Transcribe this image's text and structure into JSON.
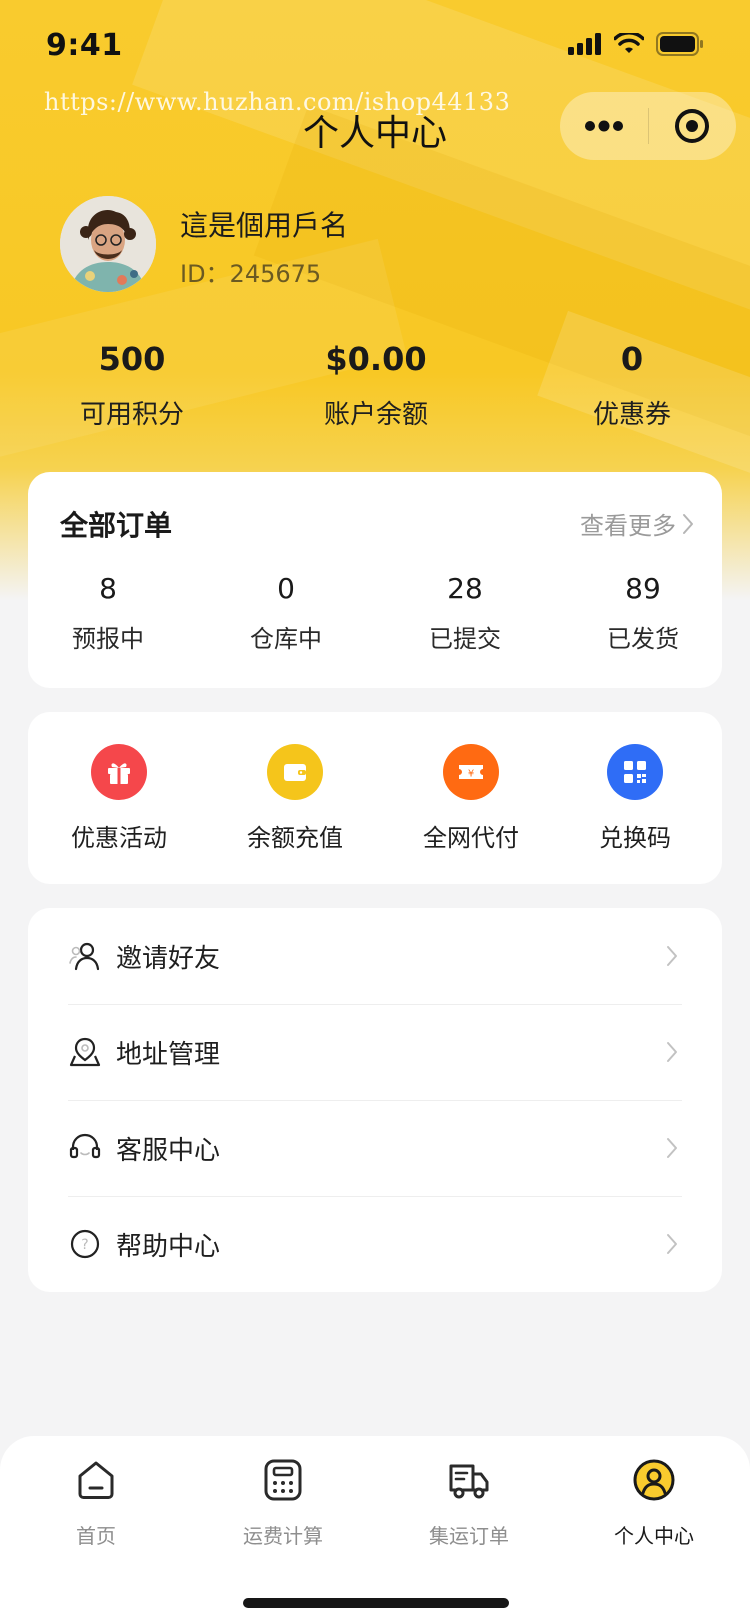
{
  "status_bar": {
    "time": "9:41",
    "icons": [
      "signal-icon",
      "wifi-icon",
      "battery-icon"
    ]
  },
  "watermark": "https://www.huzhan.com/ishop44133",
  "header": {
    "title": "个人中心",
    "capsule_icons": [
      "more-icon",
      "target-icon"
    ]
  },
  "profile": {
    "name": "這是個用戶名",
    "id_text": "ID：245675"
  },
  "stats": [
    {
      "value": "500",
      "label": "可用积分"
    },
    {
      "value": "$0.00",
      "label": "账户余额"
    },
    {
      "value": "0",
      "label": "优惠券"
    }
  ],
  "orders": {
    "title": "全部订单",
    "more_label": "查看更多",
    "items": [
      {
        "value": "8",
        "label": "预报中"
      },
      {
        "value": "0",
        "label": "仓库中"
      },
      {
        "value": "28",
        "label": "已提交"
      },
      {
        "value": "89",
        "label": "已发货"
      }
    ]
  },
  "tools": [
    {
      "label": "优惠活动",
      "icon": "gift-icon",
      "color": "#f5474b"
    },
    {
      "label": "余额充值",
      "icon": "wallet-icon",
      "color": "#f5c51b"
    },
    {
      "label": "全网代付",
      "icon": "ticket-icon",
      "color": "#ff6a12"
    },
    {
      "label": "兑换码",
      "icon": "qrcode-icon",
      "color": "#2f6df6"
    }
  ],
  "menu": [
    {
      "label": "邀请好友",
      "icon": "invite-user-icon"
    },
    {
      "label": "地址管理",
      "icon": "location-icon"
    },
    {
      "label": "客服中心",
      "icon": "headset-icon"
    },
    {
      "label": "帮助中心",
      "icon": "help-icon"
    }
  ],
  "tabbar": [
    {
      "label": "首页",
      "icon": "home-icon",
      "active": false
    },
    {
      "label": "运费计算",
      "icon": "calculator-icon",
      "active": false
    },
    {
      "label": "集运订单",
      "icon": "truck-icon",
      "active": false
    },
    {
      "label": "个人中心",
      "icon": "profile-icon",
      "active": true
    }
  ],
  "colors": {
    "brand_yellow": "#f9cb2e",
    "background": "#f4f4f5",
    "card": "#ffffff"
  }
}
